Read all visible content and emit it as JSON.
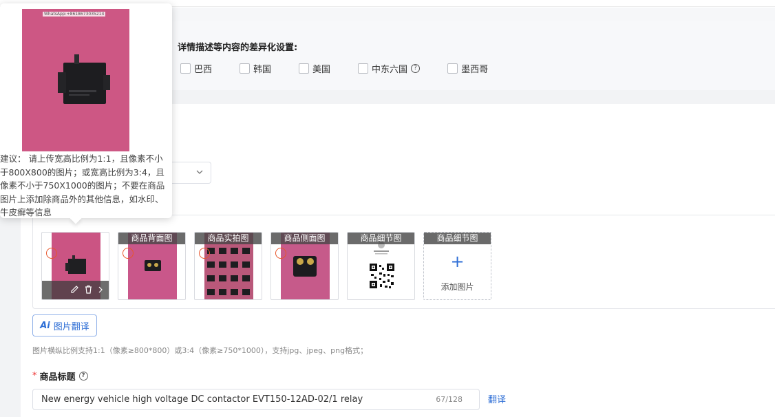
{
  "differentiation": {
    "title": "详情描述等内容的差异化设置:",
    "countries": [
      {
        "label": "巴西"
      },
      {
        "label": "韩国"
      },
      {
        "label": "美国"
      },
      {
        "label": "中东六国",
        "help": "?"
      },
      {
        "label": "墨西哥"
      }
    ]
  },
  "images": {
    "tags": [
      "商品背面图",
      "商品实拍图",
      "商品侧面图",
      "商品细节图",
      "商品细节图"
    ],
    "add_label": "添加图片",
    "add_symbol": "+"
  },
  "ai_translate": {
    "label": "图片翻译",
    "icon_text": "Ai"
  },
  "image_hint": "图片横纵比例支持1:1（像素≥800*800）或3:4（像素≥750*1000），支持jpg、jpeg、png格式；",
  "product_title": {
    "required_mark": "*",
    "label": "商品标题",
    "value": "New energy vehicle high voltage DC contactor EVT150-12AD-02/1 relay",
    "count": "67/128",
    "translate": "翻译"
  },
  "popover": {
    "watermark": "WhatsApp:+8618673035214",
    "advice": "建议：  请上传宽高比例为1:1，且像素不小于800X800的图片；或宽高比例为3:4，且像素不小于750X1000的图片；不要在商品图片上添加除商品外的其他信息，如水印、牛皮癣等信息"
  },
  "colors": {
    "accent": "#2f6fd6",
    "required": "#e33333",
    "pink_bg": "#c74f7e"
  }
}
